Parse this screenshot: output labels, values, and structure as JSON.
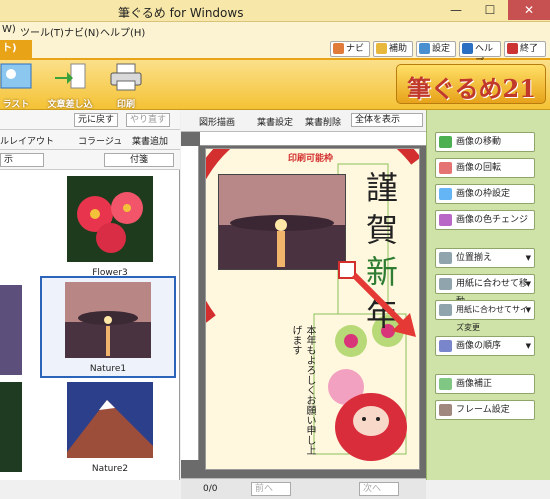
{
  "app": {
    "title": "筆ぐるめ for Windows"
  },
  "window": {
    "min": "—",
    "max": "☐",
    "close": "✕"
  },
  "menu": [
    "W)",
    "ツール(T)",
    "ナビ(N)",
    "ヘルプ(H)"
  ],
  "tab": {
    "active": "ト)"
  },
  "toolbar_buttons": [
    {
      "label": "ナビ",
      "color": "#e07b39"
    },
    {
      "label": "補助",
      "color": "#e8b83c"
    },
    {
      "label": "設定",
      "color": "#4a90d0"
    },
    {
      "label": "ヘルプ",
      "color": "#2a6fc2"
    },
    {
      "label": "終了",
      "color": "#cc3333"
    }
  ],
  "ribbon": [
    {
      "label": "ラスト"
    },
    {
      "label": "文章差し込み"
    },
    {
      "label": "印刷"
    }
  ],
  "logo": "筆ぐるめ21",
  "left": {
    "undo": "元に戻す",
    "redo": "やり直す",
    "layout": "ルレイアウト",
    "collage": "コラージュ",
    "add_card": "葉書追加",
    "view_label": "示",
    "attached": "付箋",
    "thumbs": [
      {
        "label": "Flower3"
      },
      {
        "label": "Nature1"
      },
      {
        "label": "Nature2"
      }
    ]
  },
  "canvas": {
    "shape_draw": "図形描画",
    "card_settings": "葉書設定",
    "card_delete": "葉書削除",
    "zoom": "全体を表示",
    "print_area": "印刷可能枠",
    "kanji_1": "謹",
    "kanji_2": "賀",
    "kanji_3": "新",
    "kanji_4": "年",
    "message": "本年もよろしくお願い申し上げます",
    "page": "0/0",
    "prev": "前へ",
    "next": "次へ"
  },
  "right": [
    {
      "label": "画像の移動",
      "dropdown": false
    },
    {
      "label": "画像の回転",
      "dropdown": false
    },
    {
      "label": "画像の枠設定",
      "dropdown": false
    },
    {
      "label": "画像の色チェンジ",
      "dropdown": false
    },
    {
      "label": "位置揃え",
      "dropdown": true
    },
    {
      "label": "用紙に合わせて移動",
      "dropdown": true
    },
    {
      "label": "用紙に合わせてサイズ変更",
      "dropdown": true
    },
    {
      "label": "画像の順序",
      "dropdown": true
    },
    {
      "label": "画像補正",
      "dropdown": false
    },
    {
      "label": "フレーム設定",
      "dropdown": false
    }
  ],
  "colors": {
    "accent": "#e8a317",
    "panel": "#cfe3a8",
    "selection": "#2b64b8"
  }
}
